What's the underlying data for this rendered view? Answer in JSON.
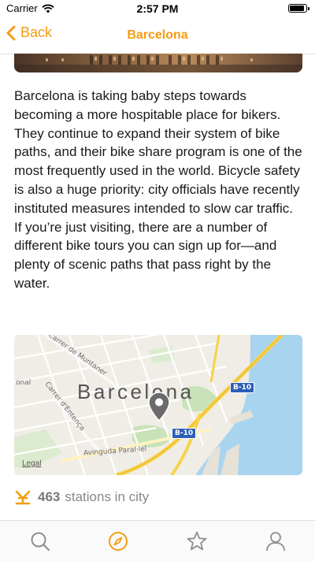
{
  "status": {
    "carrier": "Carrier",
    "time": "2:57 PM",
    "battery_level": 0.9
  },
  "nav": {
    "back_label": "Back",
    "title": "Barcelona"
  },
  "article": {
    "body": "Barcelona is taking baby steps towards becoming a more hospitable place for bikers. They continue to expand their system of bike paths, and their bike share program is one of the most frequently used in the world. Bicycle safety is also a huge priority: city officials have recently instituted measures intended to slow car traffic. If you’re just visiting, there are a number of different bike tours you can sign up for—and plenty of scenic paths that pass right by the water."
  },
  "map": {
    "city_label": "Barcelona",
    "street_1": "Carrer de Muntaner",
    "street_2": "Carrer d'Entença",
    "street_3": "Avinguda Paral·lel",
    "partial_label": "onal",
    "road_1": "B-10",
    "road_2": "B-10",
    "legal": "Legal",
    "colors": {
      "water": "#a9d4f0",
      "park": "#c9e2b9",
      "highway": "#f7d24a",
      "land": "#f0ede6"
    }
  },
  "stats": {
    "count": "463",
    "label": "stations in city",
    "icon": "bike-station-icon",
    "accent": "#f39c12"
  },
  "tabs": [
    {
      "name": "search",
      "icon": "search-icon",
      "selected": false
    },
    {
      "name": "explore",
      "icon": "compass-icon",
      "selected": true
    },
    {
      "name": "favorites",
      "icon": "star-icon",
      "selected": false
    },
    {
      "name": "profile",
      "icon": "person-icon",
      "selected": false
    }
  ]
}
